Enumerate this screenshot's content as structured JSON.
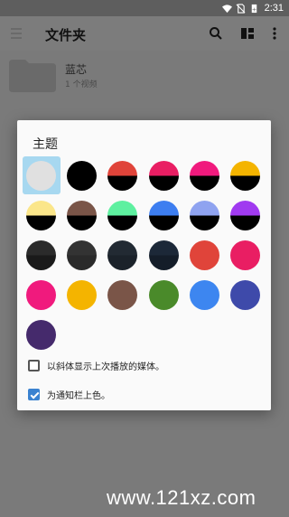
{
  "status_bar": {
    "time": "2:31",
    "icons": [
      "wifi-icon",
      "no-sim-icon",
      "battery-icon"
    ]
  },
  "app_bar": {
    "title": "文件夹",
    "icons": [
      "menu-icon",
      "search-icon",
      "layout-icon",
      "more-vert-icon"
    ]
  },
  "folder": {
    "name": "蓝芯",
    "subtitle": "1 个视频"
  },
  "dialog": {
    "title": "主题",
    "swatches": [
      {
        "name": "light-gray",
        "top": "#e0e0e0",
        "bottom": "#e0e0e0",
        "selected": true
      },
      {
        "name": "black",
        "top": "#000000",
        "bottom": "#000000"
      },
      {
        "name": "red-black",
        "top": "#e0443a",
        "bottom": "#000000"
      },
      {
        "name": "pink-black",
        "top": "#e91e63",
        "bottom": "#000000"
      },
      {
        "name": "magenta-black",
        "top": "#f01a7d",
        "bottom": "#000000"
      },
      {
        "name": "amber-black",
        "top": "#f4b400",
        "bottom": "#000000"
      },
      {
        "name": "yellow-black",
        "top": "#fbe68a",
        "bottom": "#000000"
      },
      {
        "name": "brown-black",
        "top": "#7a5548",
        "bottom": "#000000"
      },
      {
        "name": "green-black",
        "top": "#5ef0a0",
        "bottom": "#000000"
      },
      {
        "name": "blue-black",
        "top": "#3d7ef0",
        "bottom": "#000000"
      },
      {
        "name": "periwinkle-black",
        "top": "#8fa3f0",
        "bottom": "#000000"
      },
      {
        "name": "purple-black",
        "top": "#a03af0",
        "bottom": "#000000"
      },
      {
        "name": "charcoal",
        "top": "#2b2b2b",
        "bottom": "#1a1a1a"
      },
      {
        "name": "dark-gray",
        "top": "#333333",
        "bottom": "#2a2a2a"
      },
      {
        "name": "slate",
        "top": "#222a33",
        "bottom": "#1b222a"
      },
      {
        "name": "navy-dark",
        "top": "#1c2838",
        "bottom": "#141d29"
      },
      {
        "name": "red",
        "top": "#e0443a",
        "bottom": "#e0443a"
      },
      {
        "name": "pink",
        "top": "#e91e63",
        "bottom": "#e91e63"
      },
      {
        "name": "magenta",
        "top": "#f01a7d",
        "bottom": "#f01a7d"
      },
      {
        "name": "amber",
        "top": "#f4b400",
        "bottom": "#f4b400"
      },
      {
        "name": "brown",
        "top": "#7a5548",
        "bottom": "#7a5548"
      },
      {
        "name": "green",
        "top": "#4a8a2a",
        "bottom": "#4a8a2a"
      },
      {
        "name": "blue",
        "top": "#3d86f0",
        "bottom": "#3d86f0"
      },
      {
        "name": "indigo",
        "top": "#3e4aaa",
        "bottom": "#3e4aaa"
      },
      {
        "name": "deep-purple",
        "top": "#452a6c",
        "bottom": "#452a6c"
      }
    ],
    "options": [
      {
        "label": "以斜体显示上次播放的媒体。",
        "checked": false
      },
      {
        "label": "为通知栏上色。",
        "checked": true
      }
    ]
  },
  "watermark": "www.121xz.com",
  "colors": {
    "accent": "#3b82d0",
    "selected_bg": "#a7d8f0",
    "scrim": "#7a7a7a"
  }
}
